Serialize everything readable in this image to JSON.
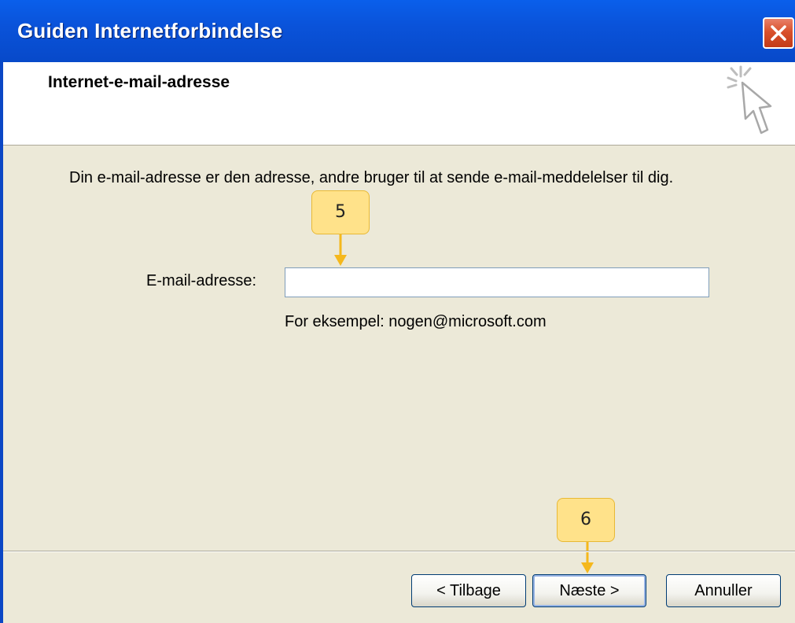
{
  "window": {
    "title": "Guiden Internetforbindelse",
    "close_icon": "close-icon"
  },
  "header": {
    "title": "Internet-e-mail-adresse",
    "icon": "sparkle-cursor-icon"
  },
  "content": {
    "description": "Din e-mail-adresse er den adresse, andre bruger til at sende e-mail-meddelelser til dig.",
    "email_label": "E-mail-adresse:",
    "email_value": "",
    "example": "For eksempel: nogen@microsoft.com"
  },
  "callouts": [
    {
      "label": "5",
      "target": "email-field"
    },
    {
      "label": "6",
      "target": "next-button"
    }
  ],
  "buttons": {
    "back": "< Tilbage",
    "next": "Næste >",
    "cancel": "Annuller"
  },
  "colors": {
    "titlebar": "#0A53DA",
    "close": "#D9512C",
    "dialog_bg": "#ECE9D8",
    "callout_bg": "#FFE28A",
    "callout_arrow": "#F5B81C"
  }
}
